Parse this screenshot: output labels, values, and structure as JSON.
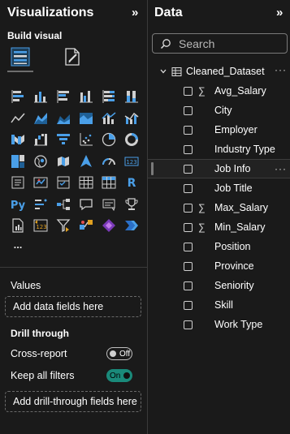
{
  "visualizations": {
    "title": "Visualizations",
    "collapse_glyph": "»",
    "build_visual_label": "Build visual",
    "tabs": [
      {
        "name": "build-visual",
        "icon": "chart-grid-icon"
      },
      {
        "name": "format-visual",
        "icon": "paintbrush-page-icon"
      }
    ],
    "more_visuals": "...",
    "visual_icons": [
      [
        "stacked-bar-icon",
        "stacked-column-icon",
        "clustered-bar-icon",
        "clustered-column-icon",
        "100-stacked-bar-icon",
        "100-stacked-column-icon"
      ],
      [
        "line-chart-icon",
        "area-chart-icon",
        "stacked-area-icon",
        "100-stacked-area-icon",
        "line-stacked-column-icon",
        "line-clustered-column-icon"
      ],
      [
        "ribbon-chart-icon",
        "waterfall-icon",
        "funnel-icon",
        "scatter-icon",
        "pie-icon",
        "donut-icon"
      ],
      [
        "treemap-icon",
        "map-icon",
        "filled-map-icon",
        "azure-map-icon",
        "gauge-icon",
        "card-icon"
      ],
      [
        "multi-row-card-icon",
        "kpi-icon",
        "slicer-icon",
        "table-icon",
        "matrix-icon",
        "r-visual-icon"
      ],
      [
        "python-visual-icon",
        "key-influencers-icon",
        "decomposition-tree-icon",
        "qa-icon",
        "smart-narrative-icon",
        "metrics-icon"
      ],
      [
        "paginated-report-icon",
        "power-apps-icon",
        "power-automate-icon",
        "arcgis-icon",
        "power-apps-2-icon",
        "power-automate-flow-icon"
      ]
    ],
    "values_label": "Values",
    "values_placeholder": "Add data fields here",
    "drill_through_label": "Drill through",
    "cross_report_label": "Cross-report",
    "cross_report_state": "Off",
    "keep_filters_label": "Keep all filters",
    "keep_filters_state": "On",
    "drill_placeholder": "Add drill-through fields here"
  },
  "data": {
    "title": "Data",
    "collapse_glyph": "»",
    "search_placeholder": "Search",
    "table": {
      "name": "Cleaned_Dataset",
      "more": "···",
      "fields": [
        {
          "label": "Avg_Salary",
          "sigma": "∑"
        },
        {
          "label": "City",
          "sigma": ""
        },
        {
          "label": "Employer",
          "sigma": ""
        },
        {
          "label": "Industry Type",
          "sigma": ""
        },
        {
          "label": "Job Info",
          "sigma": "",
          "more": "···"
        },
        {
          "label": "Job Title",
          "sigma": ""
        },
        {
          "label": "Max_Salary",
          "sigma": "∑"
        },
        {
          "label": "Min_Salary",
          "sigma": "∑"
        },
        {
          "label": "Position",
          "sigma": ""
        },
        {
          "label": "Province",
          "sigma": ""
        },
        {
          "label": "Seniority",
          "sigma": ""
        },
        {
          "label": "Skill",
          "sigma": ""
        },
        {
          "label": "Work Type",
          "sigma": ""
        }
      ]
    }
  },
  "colors": {
    "background": "#1a1a1a",
    "accent_blue": "#4a9fe8",
    "toggle_on": "#1a8a7a"
  }
}
